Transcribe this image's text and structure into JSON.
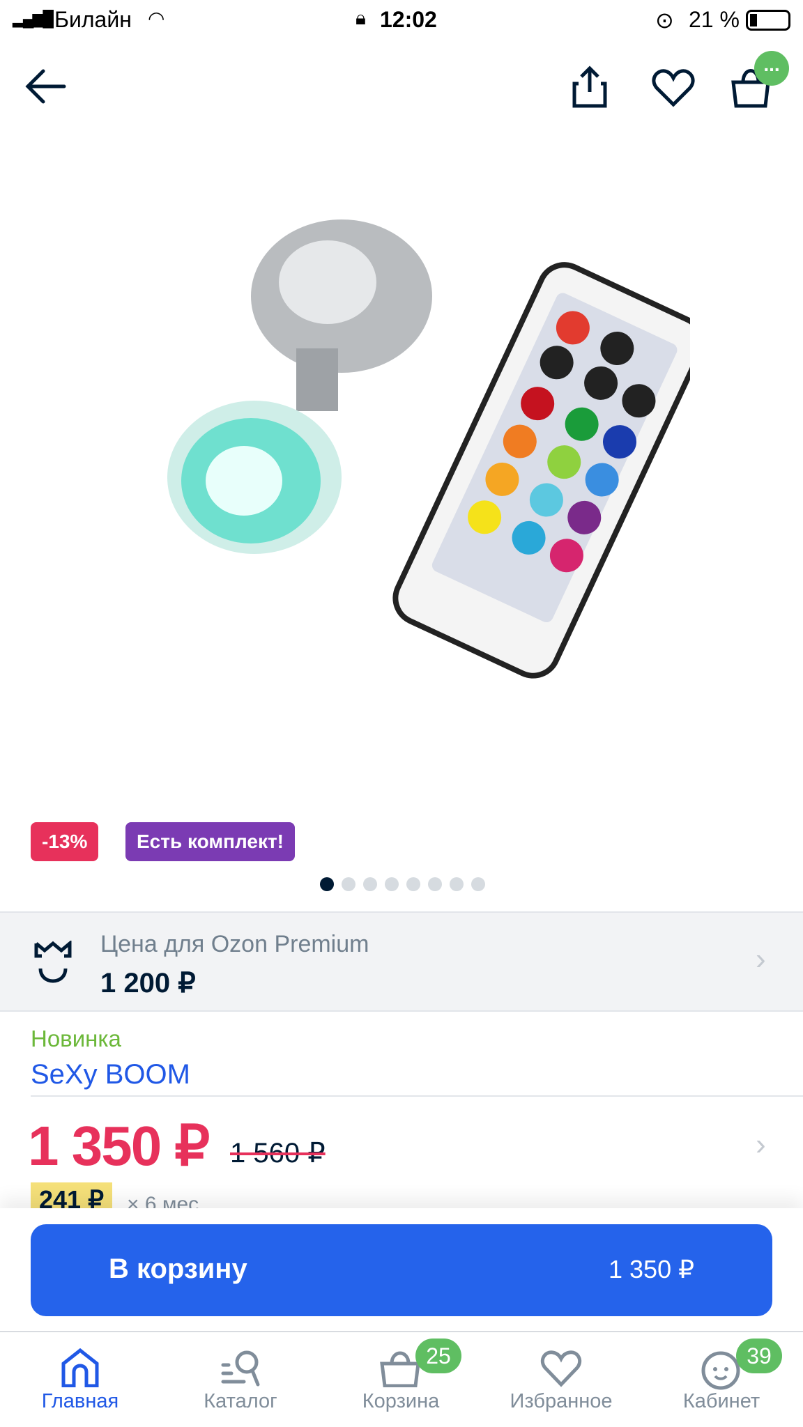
{
  "status_bar": {
    "carrier": "Билайн",
    "time": "12:02",
    "battery": "21 %"
  },
  "header": {
    "icons": [
      "back-arrow-icon",
      "share-icon",
      "heart-icon",
      "cart-icon"
    ],
    "cart_badge": "..."
  },
  "gallery": {
    "badges": [
      {
        "label": "-13%",
        "color": "#e7315b"
      },
      {
        "label": "Есть комплект!",
        "color": "#7b3bb3"
      }
    ],
    "image_count": 8,
    "current_image": 1
  },
  "premium": {
    "title": "Цена для Ozon Premium",
    "price": "1 200 ₽"
  },
  "product": {
    "tag": "Новинка",
    "brand": "SeXy BOOM",
    "price": "1 350 ₽",
    "old_price": "1 560 ₽",
    "installment": "241 ₽",
    "installment_period": "× 6 мес"
  },
  "cart_button": {
    "label": "В корзину",
    "price": "1 350 ₽",
    "color": "#2563eb"
  },
  "tabbar": {
    "items": [
      {
        "label": "Главная",
        "active": true
      },
      {
        "label": "Каталог"
      },
      {
        "label": "Корзина",
        "badge": "25"
      },
      {
        "label": "Избранное"
      },
      {
        "label": "Кабинет",
        "badge": "39"
      }
    ]
  }
}
